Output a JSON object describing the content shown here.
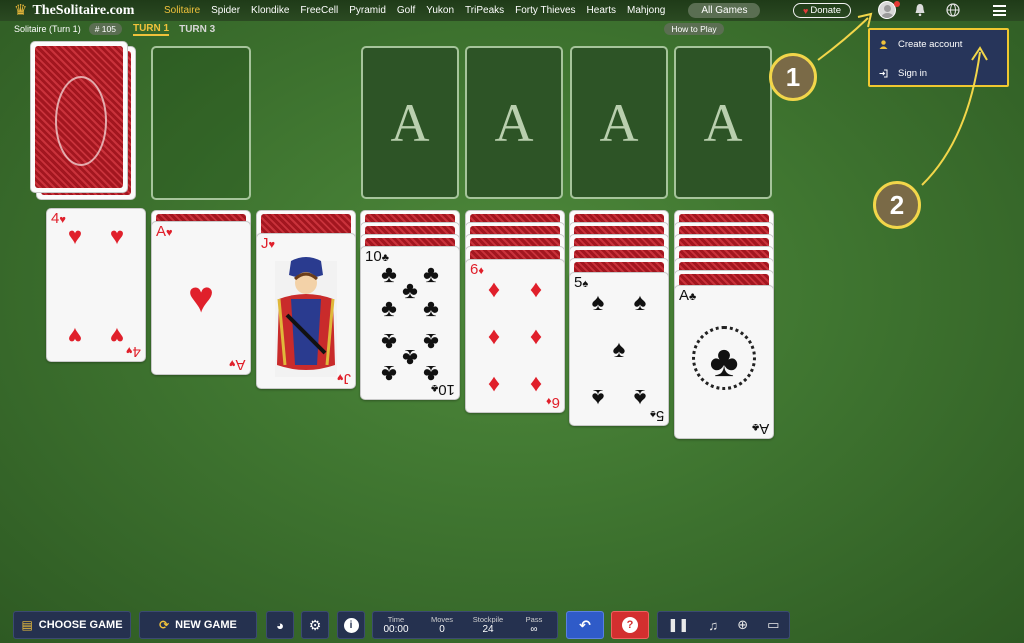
{
  "header": {
    "logo": "TheSolitaire.com",
    "nav": [
      "Solitaire",
      "Spider",
      "Klondike",
      "FreeCell",
      "Pyramid",
      "Golf",
      "Yukon",
      "TriPeaks",
      "Forty Thieves",
      "Hearts",
      "Mahjong"
    ],
    "active_nav": "Solitaire",
    "all_games": "All Games",
    "donate": "Donate"
  },
  "subbar": {
    "game_name": "Solitaire (Turn 1)",
    "game_number": "# 105",
    "turn1": "TURN 1",
    "turn3": "TURN 3",
    "how_to_play": "How to Play"
  },
  "dropdown": {
    "create_account": "Create account",
    "sign_in": "Sign in"
  },
  "callouts": [
    "1",
    "2"
  ],
  "foundation": [
    "A",
    "A",
    "A",
    "A"
  ],
  "tableau": [
    {
      "rank": "4",
      "suit": "♥",
      "color": "red"
    },
    {
      "rank": "A",
      "suit": "♥",
      "color": "red"
    },
    {
      "rank": "J",
      "suit": "♥",
      "color": "red"
    },
    {
      "rank": "10",
      "suit": "♣",
      "color": "black"
    },
    {
      "rank": "6",
      "suit": "♦",
      "color": "red"
    },
    {
      "rank": "5",
      "suit": "♠",
      "color": "black"
    },
    {
      "rank": "A",
      "suit": "♣",
      "color": "black"
    }
  ],
  "footer": {
    "choose_game": "CHOOSE GAME",
    "new_game": "NEW GAME",
    "stats": [
      {
        "label": "Time",
        "value": "00:00"
      },
      {
        "label": "Moves",
        "value": "0"
      },
      {
        "label": "Stockpile",
        "value": "24"
      },
      {
        "label": "Pass",
        "value": "∞"
      }
    ]
  },
  "colors": {
    "accent": "#f0c23b",
    "felt": "#3f7530",
    "panel": "#25314f",
    "dropdown_border": "#f0c830"
  }
}
